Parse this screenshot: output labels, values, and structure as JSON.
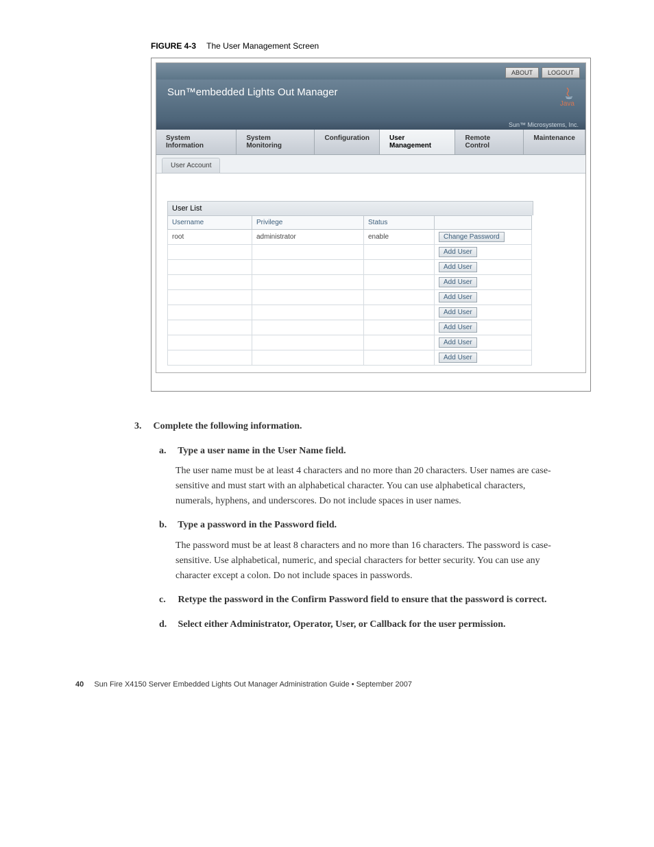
{
  "figure": {
    "label": "FIGURE 4-3",
    "caption": "The User Management Screen"
  },
  "screenshot": {
    "topbar": {
      "about": "ABOUT",
      "logout": "LOGOUT"
    },
    "title": "Sun™embedded Lights Out Manager",
    "java_label": "Java",
    "brand_line": "Sun™ Microsystems, Inc.",
    "tabs": [
      {
        "label": "System Information"
      },
      {
        "label": "System Monitoring"
      },
      {
        "label": "Configuration"
      },
      {
        "label": "User Management",
        "selected": true
      },
      {
        "label": "Remote Control"
      },
      {
        "label": "Maintenance"
      }
    ],
    "subtab": "User Account",
    "userlist_title": "User List",
    "columns": {
      "username": "Username",
      "privilege": "Privilege",
      "status": "Status"
    },
    "rows": [
      {
        "username": "root",
        "privilege": "administrator",
        "status": "enable",
        "action": "Change Password"
      },
      {
        "username": "",
        "privilege": "",
        "status": "",
        "action": "Add User"
      },
      {
        "username": "",
        "privilege": "",
        "status": "",
        "action": "Add User"
      },
      {
        "username": "",
        "privilege": "",
        "status": "",
        "action": "Add User"
      },
      {
        "username": "",
        "privilege": "",
        "status": "",
        "action": "Add User"
      },
      {
        "username": "",
        "privilege": "",
        "status": "",
        "action": "Add User"
      },
      {
        "username": "",
        "privilege": "",
        "status": "",
        "action": "Add User"
      },
      {
        "username": "",
        "privilege": "",
        "status": "",
        "action": "Add User"
      },
      {
        "username": "",
        "privilege": "",
        "status": "",
        "action": "Add User"
      }
    ]
  },
  "step3": {
    "num": "3.",
    "text": "Complete the following information."
  },
  "sub_a": {
    "letter": "a.",
    "title": "Type a user name in the User Name field.",
    "body": "The user name must be at least 4 characters and no more than 20 characters. User names are case-sensitive and must start with an alphabetical character. You can use alphabetical characters, numerals, hyphens, and underscores. Do not include spaces in user names."
  },
  "sub_b": {
    "letter": "b.",
    "title": "Type a password in the Password field.",
    "body": "The password must be at least 8 characters and no more than 16 characters. The password is case-sensitive. Use alphabetical, numeric, and special characters for better security. You can use any character except a colon. Do not include spaces in passwords."
  },
  "sub_c": {
    "letter": "c.",
    "title": "Retype the password in the Confirm Password field to ensure that the password is correct."
  },
  "sub_d": {
    "letter": "d.",
    "title": "Select either Administrator, Operator, User, or Callback for the user permission."
  },
  "footer": {
    "page": "40",
    "text": "Sun Fire X4150 Server Embedded Lights Out Manager Administration Guide • September 2007"
  }
}
